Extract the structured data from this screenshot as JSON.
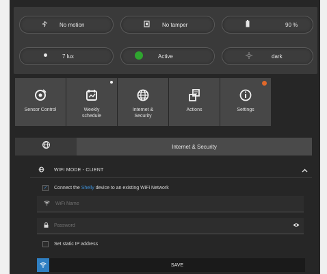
{
  "status": {
    "motion": {
      "label": "No motion",
      "icon": "running-person-icon"
    },
    "tamper": {
      "label": "No tamper",
      "icon": "tamper-sensor-icon"
    },
    "battery": {
      "label": "90 %",
      "icon": "battery-icon"
    },
    "lux": {
      "label": "7 lux",
      "icon": "sun-icon"
    },
    "state": {
      "label": "Active",
      "icon": "active-dot-icon",
      "color": "#2fa52f"
    },
    "light": {
      "label": "dark",
      "icon": "dim-sun-icon"
    }
  },
  "tiles": [
    {
      "label": "Sensor Control",
      "icon": "sensor-control-icon"
    },
    {
      "label": "Weekly\nschedule",
      "icon": "calendar-icon"
    },
    {
      "label": "Internet &\nSecurity",
      "icon": "globe-icon"
    },
    {
      "label": "Actions",
      "icon": "actions-icon"
    },
    {
      "label": "Settings",
      "icon": "info-icon"
    }
  ],
  "section": {
    "title": "Internet & Security",
    "icon": "globe-icon"
  },
  "wifi": {
    "title": "WIFI MODE - CLIENT",
    "connect_pre": "Connect the",
    "connect_brand": "Shelly",
    "connect_post": "device to an existing WiFi Network",
    "name_placeholder": "WiFi Name",
    "password_placeholder": "Password",
    "static_ip_label": "Set static IP address",
    "save_label": "SAVE"
  },
  "colors": {
    "accent_blue": "#3d8fd6",
    "active_green": "#2fa52f",
    "settings_badge": "#e0682a"
  }
}
